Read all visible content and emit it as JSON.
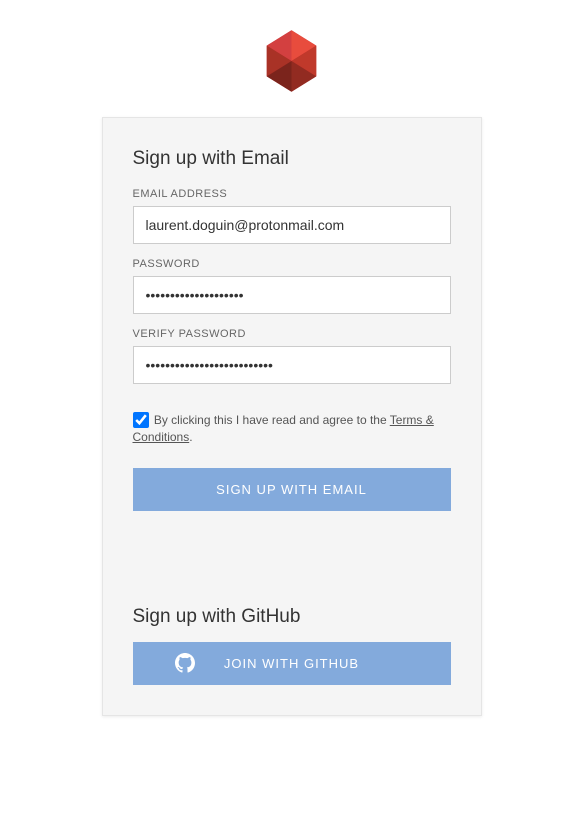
{
  "logo": {
    "name": "clever-cloud-logo"
  },
  "emailSection": {
    "heading": "Sign up with Email",
    "emailLabel": "EMAIL ADDRESS",
    "emailValue": "laurent.doguin@protonmail.com",
    "passwordLabel": "PASSWORD",
    "passwordValue": "••••••••••••••••••••",
    "verifyLabel": "VERIFY PASSWORD",
    "verifyValue": "••••••••••••••••••••••••••",
    "termsPrefix": " By clicking this I have read and agree to the ",
    "termsLink": "Terms & Conditions",
    "termsSuffix": ".",
    "termsChecked": true,
    "submitLabel": "SIGN UP WITH EMAIL"
  },
  "githubSection": {
    "heading": "Sign up with GitHub",
    "buttonLabel": "JOIN WITH GITHUB"
  },
  "colors": {
    "buttonBg": "#83aadc",
    "cardBg": "#f5f5f5"
  }
}
